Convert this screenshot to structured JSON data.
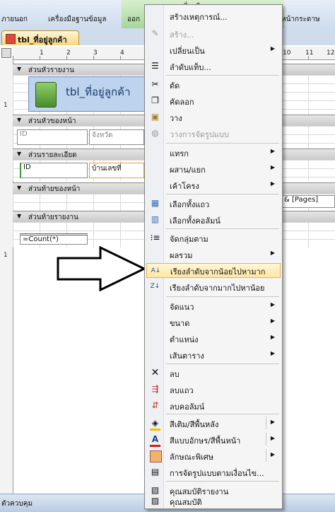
{
  "ribbon": {
    "tabs": [
      "ภายนอก",
      "เครื่องมือฐานข้อมูล",
      "ออก",
      "หน้ากระดาษ"
    ],
    "context_label": "เครื่องมือออกแบบรายงาน"
  },
  "document_tab": {
    "label": "tbl_ที่อยู่ลูกค้า"
  },
  "ruler": {
    "top_numbers": [
      "1",
      "2",
      "3",
      "4",
      "10",
      "11",
      "12"
    ],
    "left_numbers": [
      "1",
      "1",
      "1"
    ]
  },
  "sections": {
    "report_header": "ส่วนหัวรายงาน",
    "page_header": "ส่วนหัวของหน้า",
    "detail": "ส่วนรายละเอียด",
    "page_footer": "ส่วนท้ายของหน้า",
    "report_footer": "ส่วนท้ายรายงาน"
  },
  "controls": {
    "report_title": "tbl_ที่อยู่ลูกค้า",
    "id_header": "ID",
    "province_header": "จังหวัด",
    "id_field": "ID",
    "house_no_field": "บ้านเลขที่",
    "pages_field": "& [Pages]",
    "count_field": "=Count(*)"
  },
  "status_bar": {
    "text": "ตัวควบคุม"
  },
  "context_menu": {
    "items": [
      {
        "label": "สร้างเหตุการณ์...",
        "icon": "none",
        "disabled": false,
        "submenu": false
      },
      {
        "label": "สร้าง...",
        "icon": "wand-icon",
        "disabled": true,
        "submenu": false
      },
      {
        "label": "เปลี่ยนเป็น",
        "icon": "none",
        "disabled": false,
        "submenu": true
      },
      {
        "label": "ลำดับแท็บ...",
        "icon": "tab-order-icon",
        "disabled": false,
        "submenu": false
      },
      {
        "label": "ตัด",
        "icon": "scissors-icon",
        "disabled": false,
        "submenu": false
      },
      {
        "label": "คัดลอก",
        "icon": "copy-icon",
        "disabled": false,
        "submenu": false
      },
      {
        "label": "วาง",
        "icon": "paste-icon",
        "disabled": false,
        "submenu": false
      },
      {
        "label": "วางการจัดรูปแบบ",
        "icon": "paste-format-icon",
        "disabled": true,
        "submenu": false
      },
      {
        "label": "แทรก",
        "icon": "none",
        "disabled": false,
        "submenu": true
      },
      {
        "label": "ผสาน/แยก",
        "icon": "none",
        "disabled": false,
        "submenu": true
      },
      {
        "label": "เค้าโครง",
        "icon": "none",
        "disabled": false,
        "submenu": true
      },
      {
        "label": "เลือกทั้งแถว",
        "icon": "select-row-icon",
        "disabled": false,
        "submenu": false
      },
      {
        "label": "เลือกทั้งคอลัมน์",
        "icon": "select-column-icon",
        "disabled": false,
        "submenu": false
      },
      {
        "label": "จัดกลุ่มตาม",
        "icon": "group-by-icon",
        "disabled": false,
        "submenu": false
      },
      {
        "label": "ผลรวม",
        "icon": "none",
        "disabled": false,
        "submenu": true
      },
      {
        "label": "เรียงลำดับจากน้อยไปหามาก",
        "icon": "sort-ascending-icon",
        "disabled": false,
        "submenu": false,
        "highlighted": true
      },
      {
        "label": "เรียงลำดับจากมากไปหาน้อย",
        "icon": "sort-descending-icon",
        "disabled": false,
        "submenu": false
      },
      {
        "label": "จัดแนว",
        "icon": "none",
        "disabled": false,
        "submenu": true
      },
      {
        "label": "ขนาด",
        "icon": "none",
        "disabled": false,
        "submenu": true
      },
      {
        "label": "ตำแหน่ง",
        "icon": "none",
        "disabled": false,
        "submenu": true
      },
      {
        "label": "เส้นตาราง",
        "icon": "none",
        "disabled": false,
        "submenu": true
      },
      {
        "label": "ลบ",
        "icon": "delete-x-icon",
        "disabled": false,
        "submenu": false
      },
      {
        "label": "ลบแถว",
        "icon": "delete-row-icon",
        "disabled": false,
        "submenu": false
      },
      {
        "label": "ลบคอลัมน์",
        "icon": "delete-column-icon",
        "disabled": false,
        "submenu": false
      },
      {
        "label": "สีเติม/สีพื้นหลัง",
        "icon": "fill-color-icon",
        "disabled": false,
        "submenu": true,
        "split": true
      },
      {
        "label": "สีแบบอักษร/สีพื้นหน้า",
        "icon": "font-color-icon",
        "disabled": false,
        "submenu": true,
        "split": true
      },
      {
        "label": "ลักษณะพิเศษ",
        "icon": "special-effect-icon",
        "disabled": false,
        "submenu": true,
        "split": true
      },
      {
        "label": "การจัดรูปแบบตามเงื่อนไข...",
        "icon": "conditional-format-icon",
        "disabled": false,
        "submenu": false
      },
      {
        "label": "คุณสมบัติรายงาน",
        "icon": "report-properties-icon",
        "disabled": false,
        "submenu": false
      },
      {
        "label": "คุณสมบัติ",
        "icon": "properties-icon",
        "disabled": false,
        "submenu": false
      }
    ]
  },
  "colors": {
    "highlight": "#ffe7a3",
    "accent": "#f7d57a",
    "section_bg": "#d6d6d6"
  }
}
